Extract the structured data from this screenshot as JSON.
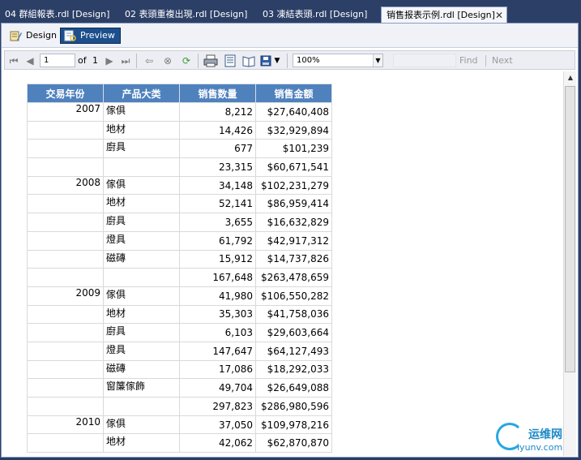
{
  "tabs": [
    {
      "label": "04 群組報表.rdl [Design]",
      "active": false
    },
    {
      "label": "02 表頭重複出現.rdl [Design]",
      "active": false
    },
    {
      "label": "03 凍結表頭.rdl [Design]",
      "active": false
    },
    {
      "label": "销售报表示例.rdl [Design]",
      "active": true
    }
  ],
  "mode": {
    "design": "Design",
    "preview": "Preview"
  },
  "toolbar": {
    "page_value": "1",
    "of_label": "of",
    "total_pages": "1",
    "zoom": "100%",
    "find": "Find",
    "next": "Next",
    "icons": [
      "first-page-icon",
      "prev-page-icon",
      "next-page-icon",
      "last-page-icon",
      "back-icon",
      "stop-icon",
      "refresh-icon",
      "print-icon",
      "print-layout-icon",
      "page-setup-icon",
      "export-icon"
    ]
  },
  "report": {
    "headers": [
      "交易年份",
      "产品大类",
      "销售数量",
      "销售金额"
    ],
    "header_color": "#4f81bd",
    "groups": [
      {
        "year": "2007",
        "rows": [
          {
            "cat": "傢俱",
            "qty": "8,212",
            "amt": "$27,640,408"
          },
          {
            "cat": "地材",
            "qty": "14,426",
            "amt": "$32,929,894"
          },
          {
            "cat": "廚具",
            "qty": "677",
            "amt": "$101,239"
          },
          {
            "cat": "",
            "qty": "23,315",
            "amt": "$60,671,541"
          }
        ]
      },
      {
        "year": "2008",
        "rows": [
          {
            "cat": "傢俱",
            "qty": "34,148",
            "amt": "$102,231,279"
          },
          {
            "cat": "地材",
            "qty": "52,141",
            "amt": "$86,959,414"
          },
          {
            "cat": "廚具",
            "qty": "3,655",
            "amt": "$16,632,829"
          },
          {
            "cat": "燈具",
            "qty": "61,792",
            "amt": "$42,917,312"
          },
          {
            "cat": "磁磚",
            "qty": "15,912",
            "amt": "$14,737,826"
          },
          {
            "cat": "",
            "qty": "167,648",
            "amt": "$263,478,659"
          }
        ]
      },
      {
        "year": "2009",
        "rows": [
          {
            "cat": "傢俱",
            "qty": "41,980",
            "amt": "$106,550,282"
          },
          {
            "cat": "地材",
            "qty": "35,303",
            "amt": "$41,758,036"
          },
          {
            "cat": "廚具",
            "qty": "6,103",
            "amt": "$29,603,664"
          },
          {
            "cat": "燈具",
            "qty": "147,647",
            "amt": "$64,127,493"
          },
          {
            "cat": "磁磚",
            "qty": "17,086",
            "amt": "$18,292,033"
          },
          {
            "cat": "窗簾傢飾",
            "qty": "49,704",
            "amt": "$26,649,088"
          },
          {
            "cat": "",
            "qty": "297,823",
            "amt": "$286,980,596"
          }
        ]
      },
      {
        "year": "2010",
        "rows": [
          {
            "cat": "傢俱",
            "qty": "37,050",
            "amt": "$109,978,216"
          },
          {
            "cat": "地材",
            "qty": "42,062",
            "amt": "$62,870,870"
          }
        ]
      }
    ]
  },
  "watermark": {
    "title": "运维网",
    "url": "iyunv.com"
  }
}
